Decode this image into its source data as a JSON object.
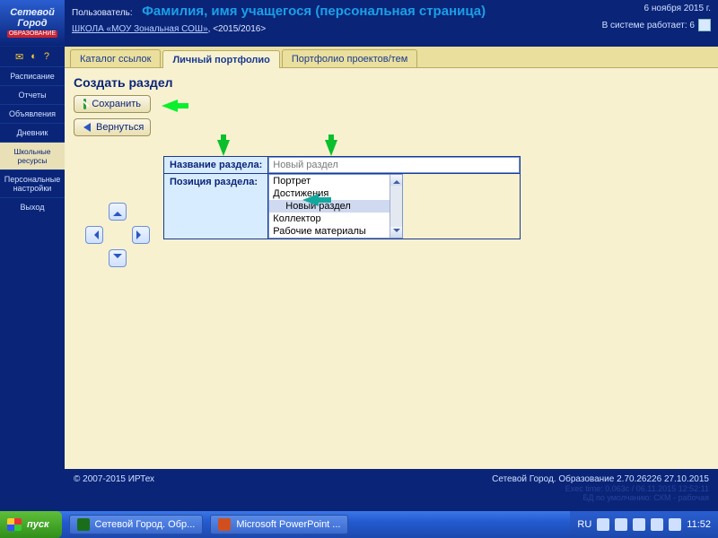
{
  "logo": {
    "line1": "Сетевой",
    "line2": "Город",
    "band": "ОБРАЗОВАНИЕ"
  },
  "header": {
    "user_label": "Пользователь:",
    "title": "Фамилия, имя учащегося (персональная страница)",
    "school_link": "ШКОЛА «МОУ Зональная СОШ»",
    "year": "<2015/2016>",
    "date": "6 ноября 2015 г.",
    "online_label": "В системе работает: 6"
  },
  "sidebar": {
    "items": [
      {
        "label": "Расписание"
      },
      {
        "label": "Отчеты"
      },
      {
        "label": "Объявления"
      },
      {
        "label": "Дневник"
      },
      {
        "label": "Школьные ресурсы"
      },
      {
        "label": "Персональные настройки"
      },
      {
        "label": "Выход"
      }
    ]
  },
  "tabs": [
    {
      "label": "Каталог ссылок"
    },
    {
      "label": "Личный портфолио"
    },
    {
      "label": "Портфолио проектов/тем"
    }
  ],
  "page": {
    "section_title": "Создать раздел",
    "save_label": "Сохранить",
    "back_label": "Вернуться",
    "name_field_label": "Название раздела:",
    "name_field_value": "Новый раздел",
    "pos_field_label": "Позиция раздела:",
    "options": [
      {
        "label": "Портрет"
      },
      {
        "label": "Достижения"
      },
      {
        "label": "Новый раздел"
      },
      {
        "label": "Коллектор"
      },
      {
        "label": "Рабочие материалы"
      }
    ],
    "selected_option_index": 2
  },
  "footer": {
    "copyright": "© 2007-2015 ИРТех",
    "product": "Сетевой Город. Образование 2.70.26226   27.10.2015",
    "line2": "Exec time: 0,063с / 06.11.2015 12:52:11",
    "line3": "БД по умолчанию: СКМ - рабочая"
  },
  "taskbar": {
    "start": "пуск",
    "tasks": [
      {
        "label": "Сетевой Город. Обр..."
      },
      {
        "label": "Microsoft PowerPoint ..."
      }
    ],
    "lang": "RU",
    "clock": "11:52"
  }
}
